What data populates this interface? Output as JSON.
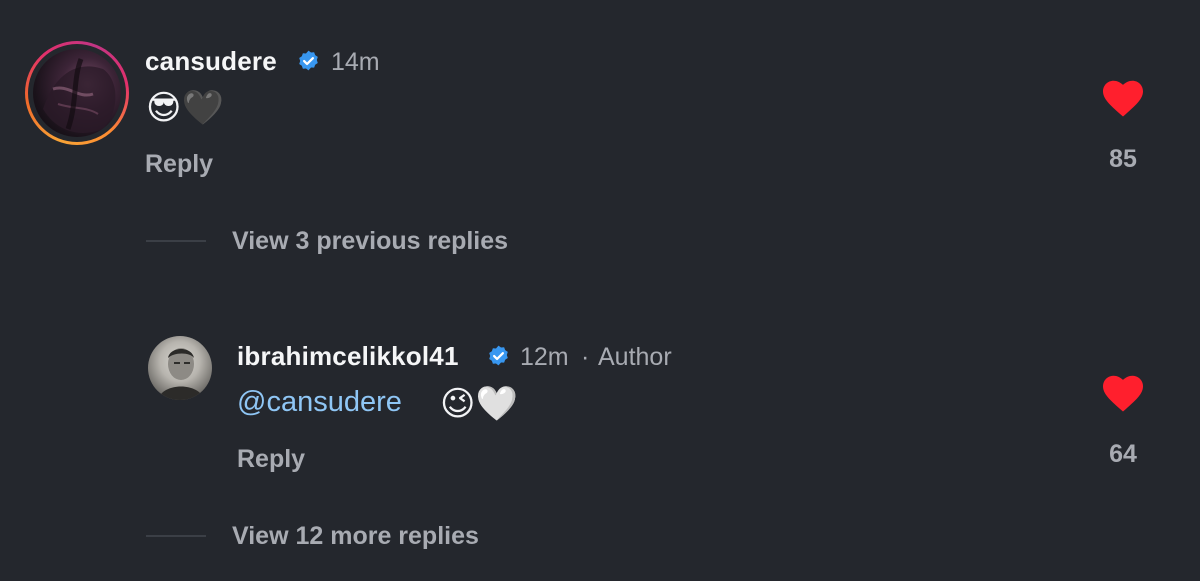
{
  "comments": [
    {
      "username": "cansudere",
      "time": "14m",
      "text": "😎🖤",
      "reply_label": "Reply",
      "likes": "85"
    }
  ],
  "view_previous": "View 3 previous replies",
  "replies": [
    {
      "username": "ibrahimcelikkol41",
      "time": "12m",
      "separator": "·",
      "badge": "Author",
      "mention": "@cansudere",
      "emojis": "😉🤍",
      "reply_label": "Reply",
      "likes": "64"
    }
  ],
  "view_more": "View 12 more replies",
  "colors": {
    "background": "#24272d",
    "heart": "#ff1f2d",
    "verified": "#3897f0",
    "mention": "#8fc6f5",
    "muted_text": "#a8abb2"
  },
  "icons": {
    "verified": "verified-badge-icon",
    "like": "heart-icon"
  }
}
